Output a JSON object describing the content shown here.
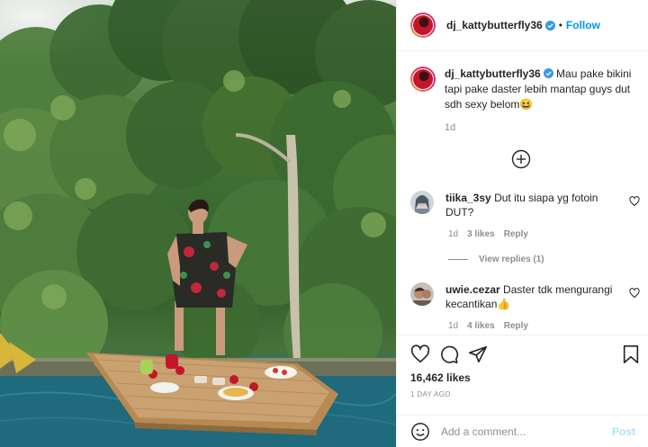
{
  "post": {
    "username": "dj_kattybutterfly36",
    "follow_separator": "•",
    "follow_label": "Follow",
    "caption_username": "dj_kattybutterfly36",
    "caption_text": "Mau pake bikini tapi pake daster lebih mantap guys dut sdh sexy belom😆",
    "caption_age": "1d",
    "likes": "16,462 likes",
    "date": "1 DAY AGO",
    "comment_placeholder": "Add a comment...",
    "post_label": "Post"
  },
  "comments": [
    {
      "username": "tiika_3sy",
      "text": "Dut itu siapa yg fotoin DUT?",
      "age": "1d",
      "likes": "3 likes",
      "reply_label": "Reply",
      "view_replies": "View replies (1)"
    },
    {
      "username": "uwie.cezar",
      "text": "Daster tdk mengurangi kecantikan👍",
      "age": "1d",
      "likes": "4 likes",
      "reply_label": "Reply"
    }
  ],
  "colors": {
    "link_blue": "#0095f6",
    "post_disabled": "#b2dffc",
    "muted_gray": "#8e8e8e",
    "verified_blue": "#3897f0"
  },
  "icons": [
    "verified-icon",
    "add-circle-icon",
    "heart-icon",
    "comment-icon",
    "share-icon",
    "bookmark-icon",
    "emoji-icon"
  ]
}
